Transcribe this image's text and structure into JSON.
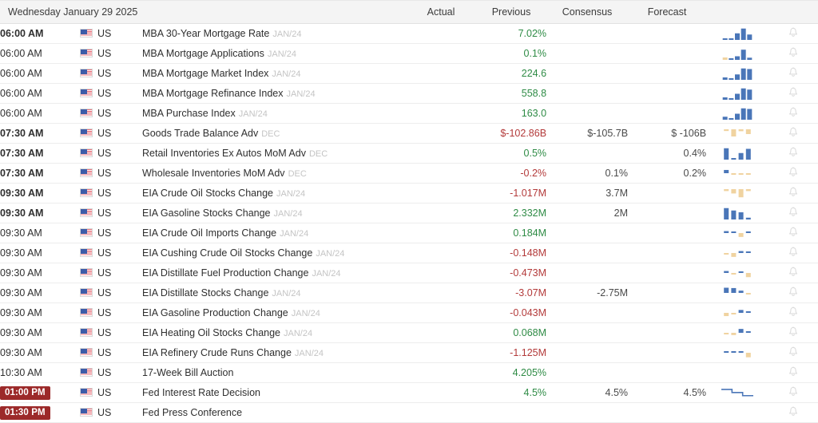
{
  "header": {
    "date_label": "Wednesday January 29 2025",
    "columns": [
      {
        "key": "actual",
        "label": "Actual"
      },
      {
        "key": "previous",
        "label": "Previous"
      },
      {
        "key": "consensus",
        "label": "Consensus"
      },
      {
        "key": "forecast",
        "label": "Forecast"
      }
    ]
  },
  "colors": {
    "positive": "#2e8b45",
    "negative": "#b33a3a",
    "neutral": "#4a4a4a",
    "badge_background": "#9c2a2a",
    "header_background": "#f4f4f4",
    "bar_blue": "#4a76b8",
    "bar_tan": "#f0d3a0",
    "bell": "#dcdcdc"
  },
  "icons": {
    "flag": "us-flag-icon",
    "bell": "bell-icon",
    "chart": "sparkline-chart-icon"
  },
  "rows": [
    {
      "time": "06:00 AM",
      "time_bold": true,
      "time_badge": false,
      "country": "US",
      "event": "MBA 30-Year Mortgage Rate",
      "reference": "JAN/24",
      "actual": "",
      "previous": "7.02%",
      "previous_tone": "pos",
      "consensus": "",
      "forecast": "",
      "chart": {
        "type": "bars",
        "values": [
          0.12,
          0.05,
          0.55,
          0.95,
          0.45
        ],
        "colors": [
          "blue",
          "blue",
          "blue",
          "blue",
          "blue"
        ]
      }
    },
    {
      "time": "06:00 AM",
      "time_bold": false,
      "time_badge": false,
      "country": "US",
      "event": "MBA Mortgage Applications",
      "reference": "JAN/24",
      "actual": "",
      "previous": "0.1%",
      "previous_tone": "pos",
      "consensus": "",
      "forecast": "",
      "chart": {
        "type": "bars",
        "values": [
          0.2,
          0.08,
          0.3,
          0.85,
          0.18
        ],
        "colors": [
          "tan",
          "blue",
          "blue",
          "blue",
          "blue"
        ]
      }
    },
    {
      "time": "06:00 AM",
      "time_bold": false,
      "time_badge": false,
      "country": "US",
      "event": "MBA Mortgage Market Index",
      "reference": "JAN/24",
      "actual": "",
      "previous": "224.6",
      "previous_tone": "pos",
      "consensus": "",
      "forecast": "",
      "chart": {
        "type": "bars",
        "values": [
          0.2,
          0.1,
          0.45,
          0.95,
          0.9
        ],
        "colors": [
          "blue",
          "blue",
          "blue",
          "blue",
          "blue"
        ]
      }
    },
    {
      "time": "06:00 AM",
      "time_bold": false,
      "time_badge": false,
      "country": "US",
      "event": "MBA Mortgage Refinance Index",
      "reference": "JAN/24",
      "actual": "",
      "previous": "558.8",
      "previous_tone": "pos",
      "consensus": "",
      "forecast": "",
      "chart": {
        "type": "bars",
        "values": [
          0.2,
          0.12,
          0.5,
          0.95,
          0.85
        ],
        "colors": [
          "blue",
          "blue",
          "blue",
          "blue",
          "blue"
        ]
      }
    },
    {
      "time": "06:00 AM",
      "time_bold": false,
      "time_badge": false,
      "country": "US",
      "event": "MBA Purchase Index",
      "reference": "JAN/24",
      "actual": "",
      "previous": "163.0",
      "previous_tone": "pos",
      "consensus": "",
      "forecast": "",
      "chart": {
        "type": "bars",
        "values": [
          0.25,
          0.12,
          0.5,
          0.95,
          0.9
        ],
        "colors": [
          "blue",
          "blue",
          "blue",
          "blue",
          "blue"
        ]
      }
    },
    {
      "time": "07:30 AM",
      "time_bold": true,
      "time_badge": false,
      "country": "US",
      "event": "Goods Trade Balance Adv",
      "reference": "DEC",
      "actual": "",
      "previous": "$-102.86B",
      "previous_tone": "neg",
      "consensus": "$-105.7B",
      "forecast": "$ -106B",
      "chart": {
        "type": "bars-neg",
        "values": [
          0.18,
          0.75,
          0.2,
          0.5
        ],
        "colors": [
          "tan",
          "tan",
          "tan",
          "tan"
        ]
      }
    },
    {
      "time": "07:30 AM",
      "time_bold": true,
      "time_badge": false,
      "country": "US",
      "event": "Retail Inventories Ex Autos MoM Adv",
      "reference": "DEC",
      "actual": "",
      "previous": "0.5%",
      "previous_tone": "pos",
      "consensus": "",
      "forecast": "0.4%",
      "chart": {
        "type": "bars",
        "values": [
          0.95,
          0.12,
          0.55,
          0.9
        ],
        "colors": [
          "blue",
          "blue",
          "blue",
          "blue"
        ]
      }
    },
    {
      "time": "07:30 AM",
      "time_bold": true,
      "time_badge": false,
      "country": "US",
      "event": "Wholesale Inventories MoM Adv",
      "reference": "DEC",
      "actual": "",
      "previous": "-0.2%",
      "previous_tone": "neg",
      "consensus": "0.1%",
      "forecast": "0.2%",
      "chart": {
        "type": "bars-mixed",
        "values": [
          0.5,
          0.12,
          0.08,
          0.12
        ],
        "colors": [
          "blue",
          "tan",
          "tan",
          "tan"
        ]
      }
    },
    {
      "time": "09:30 AM",
      "time_bold": true,
      "time_badge": false,
      "country": "US",
      "event": "EIA Crude Oil Stocks Change",
      "reference": "JAN/24",
      "actual": "",
      "previous": "-1.017M",
      "previous_tone": "neg",
      "consensus": "3.7M",
      "forecast": "",
      "chart": {
        "type": "bars-neg",
        "values": [
          0.2,
          0.45,
          0.85,
          0.2
        ],
        "colors": [
          "tan",
          "tan",
          "tan",
          "tan"
        ]
      }
    },
    {
      "time": "09:30 AM",
      "time_bold": true,
      "time_badge": false,
      "country": "US",
      "event": "EIA Gasoline Stocks Change",
      "reference": "JAN/24",
      "actual": "",
      "previous": "2.332M",
      "previous_tone": "pos",
      "consensus": "2M",
      "forecast": "",
      "chart": {
        "type": "bars",
        "values": [
          0.95,
          0.75,
          0.6,
          0.15
        ],
        "colors": [
          "blue",
          "blue",
          "blue",
          "blue"
        ]
      }
    },
    {
      "time": "09:30 AM",
      "time_bold": false,
      "time_badge": false,
      "country": "US",
      "event": "EIA Crude Oil Imports Change",
      "reference": "JAN/24",
      "actual": "",
      "previous": "0.184M",
      "previous_tone": "pos",
      "consensus": "",
      "forecast": "",
      "chart": {
        "type": "bars-mixed",
        "values": [
          0.3,
          0.15,
          0.6,
          0.25
        ],
        "colors": [
          "blue",
          "blue",
          "tan",
          "blue"
        ]
      }
    },
    {
      "time": "09:30 AM",
      "time_bold": false,
      "time_badge": false,
      "country": "US",
      "event": "EIA Cushing Crude Oil Stocks Change",
      "reference": "JAN/24",
      "actual": "",
      "previous": "-0.148M",
      "previous_tone": "neg",
      "consensus": "",
      "forecast": "",
      "chart": {
        "type": "bars-mixed",
        "values": [
          0.18,
          0.6,
          0.3,
          0.12
        ],
        "colors": [
          "tan",
          "tan",
          "blue",
          "blue"
        ]
      }
    },
    {
      "time": "09:30 AM",
      "time_bold": false,
      "time_badge": false,
      "country": "US",
      "event": "EIA Distillate Fuel Production Change",
      "reference": "JAN/24",
      "actual": "",
      "previous": "-0.473M",
      "previous_tone": "neg",
      "consensus": "",
      "forecast": "",
      "chart": {
        "type": "bars-mixed",
        "values": [
          0.3,
          0.12,
          0.2,
          0.65
        ],
        "colors": [
          "blue",
          "tan",
          "blue",
          "tan"
        ]
      }
    },
    {
      "time": "09:30 AM",
      "time_bold": false,
      "time_badge": false,
      "country": "US",
      "event": "EIA Distillate Stocks Change",
      "reference": "JAN/24",
      "actual": "",
      "previous": "-3.07M",
      "previous_tone": "neg",
      "consensus": "-2.75M",
      "forecast": "",
      "chart": {
        "type": "bars-mixed",
        "values": [
          0.8,
          0.75,
          0.35,
          0.15
        ],
        "colors": [
          "blue",
          "blue",
          "blue",
          "tan"
        ]
      }
    },
    {
      "time": "09:30 AM",
      "time_bold": false,
      "time_badge": false,
      "country": "US",
      "event": "EIA Gasoline Production Change",
      "reference": "JAN/24",
      "actual": "",
      "previous": "-0.043M",
      "previous_tone": "neg",
      "consensus": "",
      "forecast": "",
      "chart": {
        "type": "bars-mixed",
        "values": [
          0.5,
          0.12,
          0.45,
          0.15
        ],
        "colors": [
          "tan",
          "tan",
          "blue",
          "blue"
        ]
      }
    },
    {
      "time": "09:30 AM",
      "time_bold": false,
      "time_badge": false,
      "country": "US",
      "event": "EIA Heating Oil Stocks Change",
      "reference": "JAN/24",
      "actual": "",
      "previous": "0.068M",
      "previous_tone": "pos",
      "consensus": "",
      "forecast": "",
      "chart": {
        "type": "bars-mixed",
        "values": [
          0.18,
          0.35,
          0.6,
          0.2
        ],
        "colors": [
          "tan",
          "tan",
          "blue",
          "blue"
        ]
      }
    },
    {
      "time": "09:30 AM",
      "time_bold": false,
      "time_badge": false,
      "country": "US",
      "event": "EIA Refinery Crude Runs Change",
      "reference": "JAN/24",
      "actual": "",
      "previous": "-1.125M",
      "previous_tone": "neg",
      "consensus": "",
      "forecast": "",
      "chart": {
        "type": "bars-mixed",
        "values": [
          0.2,
          0.2,
          0.25,
          0.7
        ],
        "colors": [
          "blue",
          "blue",
          "blue",
          "tan"
        ]
      }
    },
    {
      "time": "10:30 AM",
      "time_bold": false,
      "time_badge": false,
      "country": "US",
      "event": "17-Week Bill Auction",
      "reference": "",
      "actual": "",
      "previous": "4.205%",
      "previous_tone": "pos",
      "consensus": "",
      "forecast": "",
      "chart": {
        "type": "none",
        "values": [],
        "colors": []
      }
    },
    {
      "time": "01:00 PM",
      "time_bold": true,
      "time_badge": true,
      "country": "US",
      "event": "Fed Interest Rate Decision",
      "reference": "",
      "actual": "",
      "previous": "4.5%",
      "previous_tone": "pos",
      "consensus": "4.5%",
      "forecast": "4.5%",
      "chart": {
        "type": "step-line",
        "values": [
          0.85,
          0.85,
          0.55,
          0.55,
          0.25,
          0.25
        ],
        "colors": []
      }
    },
    {
      "time": "01:30 PM",
      "time_bold": true,
      "time_badge": true,
      "country": "US",
      "event": "Fed Press Conference",
      "reference": "",
      "actual": "",
      "previous": "",
      "previous_tone": "plain",
      "consensus": "",
      "forecast": "",
      "chart": {
        "type": "none",
        "values": [],
        "colors": []
      }
    }
  ]
}
